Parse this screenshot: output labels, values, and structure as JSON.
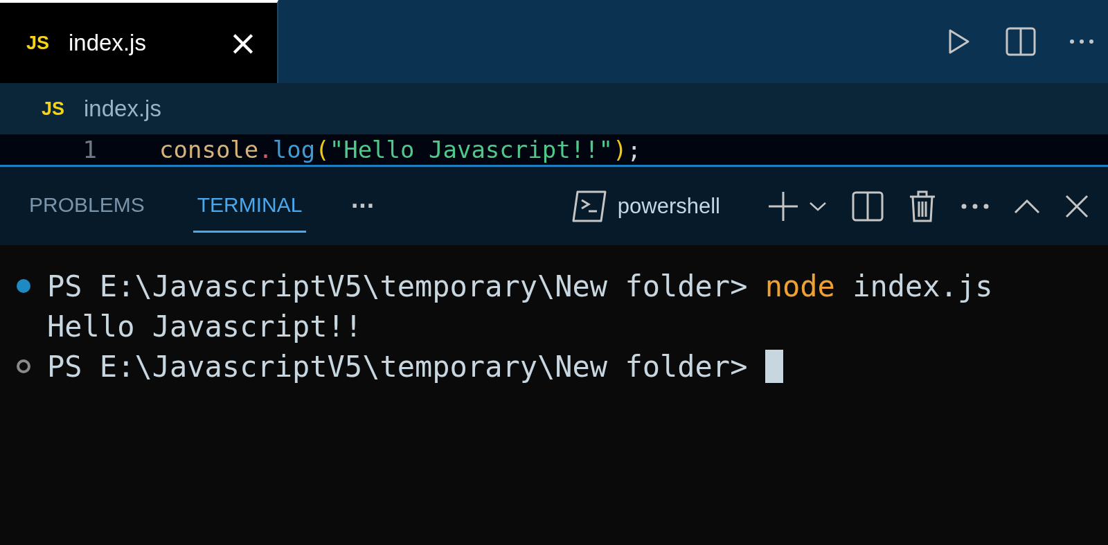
{
  "tabs": [
    {
      "icon_text": "JS",
      "label": "index.js",
      "close": "×",
      "selected": true
    }
  ],
  "breadcrumb": {
    "icon_text": "JS",
    "label": "index.js"
  },
  "code": [
    {
      "number": "1",
      "tokens": [
        {
          "text": "console",
          "kind": "variable"
        },
        {
          "text": ".",
          "kind": "punct"
        },
        {
          "text": "log",
          "kind": "function"
        },
        {
          "text": "(",
          "kind": "bracket"
        },
        {
          "text": "\"Hello Javascript!!\"",
          "kind": "string"
        },
        {
          "text": ")",
          "kind": "bracket"
        },
        {
          "text": ";",
          "kind": "plain"
        }
      ]
    }
  ],
  "panel": {
    "tabs": [
      {
        "label": "PROBLEMS",
        "selected": false
      },
      {
        "label": "TERMINAL",
        "selected": true
      }
    ],
    "more": "···",
    "shell": "powershell"
  },
  "terminal": [
    {
      "marker": true,
      "succeeded": true,
      "segments": [
        {
          "text": "PS E:\\JavascriptV5\\temporary\\New folder> ",
          "kind": "plain"
        },
        {
          "text": "node",
          "kind": "command"
        },
        {
          "text": " index.js",
          "kind": "plain"
        }
      ],
      "cursor": false
    },
    {
      "marker": false,
      "segments": [
        {
          "text": "Hello Javascript!!",
          "kind": "plain"
        }
      ],
      "cursor": false
    },
    {
      "marker": true,
      "succeeded": false,
      "segments": [
        {
          "text": "PS E:\\JavascriptV5\\temporary\\New folder> ",
          "kind": "plain"
        }
      ],
      "cursor": true
    }
  ]
}
